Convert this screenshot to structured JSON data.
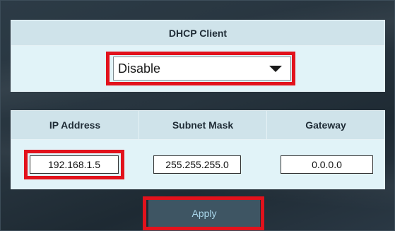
{
  "dhcp": {
    "header": "DHCP Client",
    "selected": "Disable",
    "options": [
      "Disable"
    ]
  },
  "ip_table": {
    "columns": [
      "IP Address",
      "Subnet Mask",
      "Gateway"
    ],
    "values": {
      "ip_address": "192.168.1.5",
      "subnet_mask": "255.255.255.0",
      "gateway": "0.0.0.0"
    }
  },
  "actions": {
    "apply": "Apply"
  },
  "colors": {
    "highlight": "#e2121c",
    "header_bg": "#cfe3ea",
    "body_bg": "#e1f3f8",
    "apply_bg": "#3e5563",
    "apply_text": "#a9d6ea"
  },
  "icons": {
    "select_caret": "triangle-down"
  }
}
